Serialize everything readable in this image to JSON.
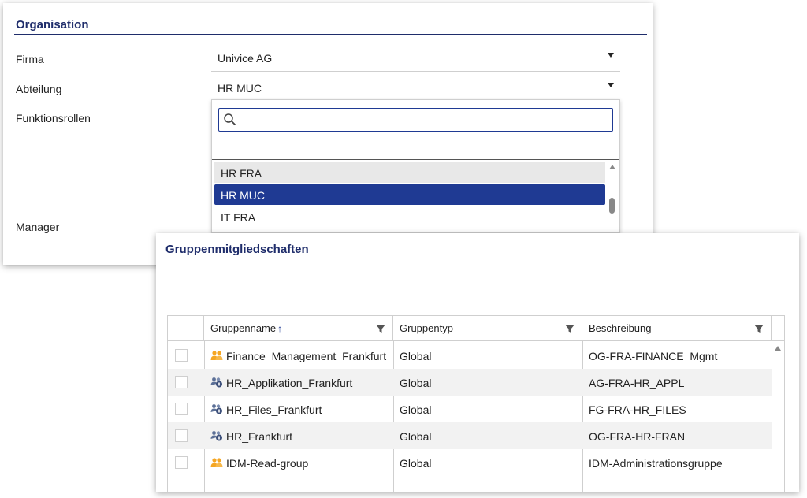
{
  "organisation": {
    "title": "Organisation",
    "fields": {
      "firma": {
        "label": "Firma",
        "value": "Univice AG"
      },
      "abteilung": {
        "label": "Abteilung",
        "value": "HR MUC"
      },
      "funktionsrollen": {
        "label": "Funktionsrollen"
      },
      "manager": {
        "label": "Manager"
      }
    },
    "dropdown": {
      "search_value": "",
      "options": [
        "HR FRA",
        "HR MUC",
        "IT FRA"
      ],
      "selected": "HR MUC"
    }
  },
  "groups": {
    "title": "Gruppenmitgliedschaften",
    "columns": {
      "name": "Gruppenname",
      "sort_indicator": "↑",
      "type": "Gruppentyp",
      "description": "Beschreibung"
    },
    "rows": [
      {
        "name": "Finance_Management_Frankfurt",
        "type": "Global",
        "description": "OG-FRA-FINANCE_Mgmt",
        "icon": "org-group-icon"
      },
      {
        "name": "HR_Applikation_Frankfurt",
        "type": "Global",
        "description": "AG-FRA-HR_APPL",
        "icon": "security-group-icon"
      },
      {
        "name": "HR_Files_Frankfurt",
        "type": "Global",
        "description": "FG-FRA-HR_FILES",
        "icon": "security-group-icon"
      },
      {
        "name": "HR_Frankfurt",
        "type": "Global",
        "description": "OG-FRA-HR-FRAN",
        "icon": "security-group-icon"
      },
      {
        "name": "IDM-Read-group",
        "type": "Global",
        "description": "IDM-Administrationsgruppe",
        "icon": "org-group-icon"
      }
    ]
  },
  "colors": {
    "accent": "#1f3a93",
    "heading": "#1f2d6b",
    "org_group_icon": "#f5a623",
    "security_group_icon": "#5b6f96"
  }
}
